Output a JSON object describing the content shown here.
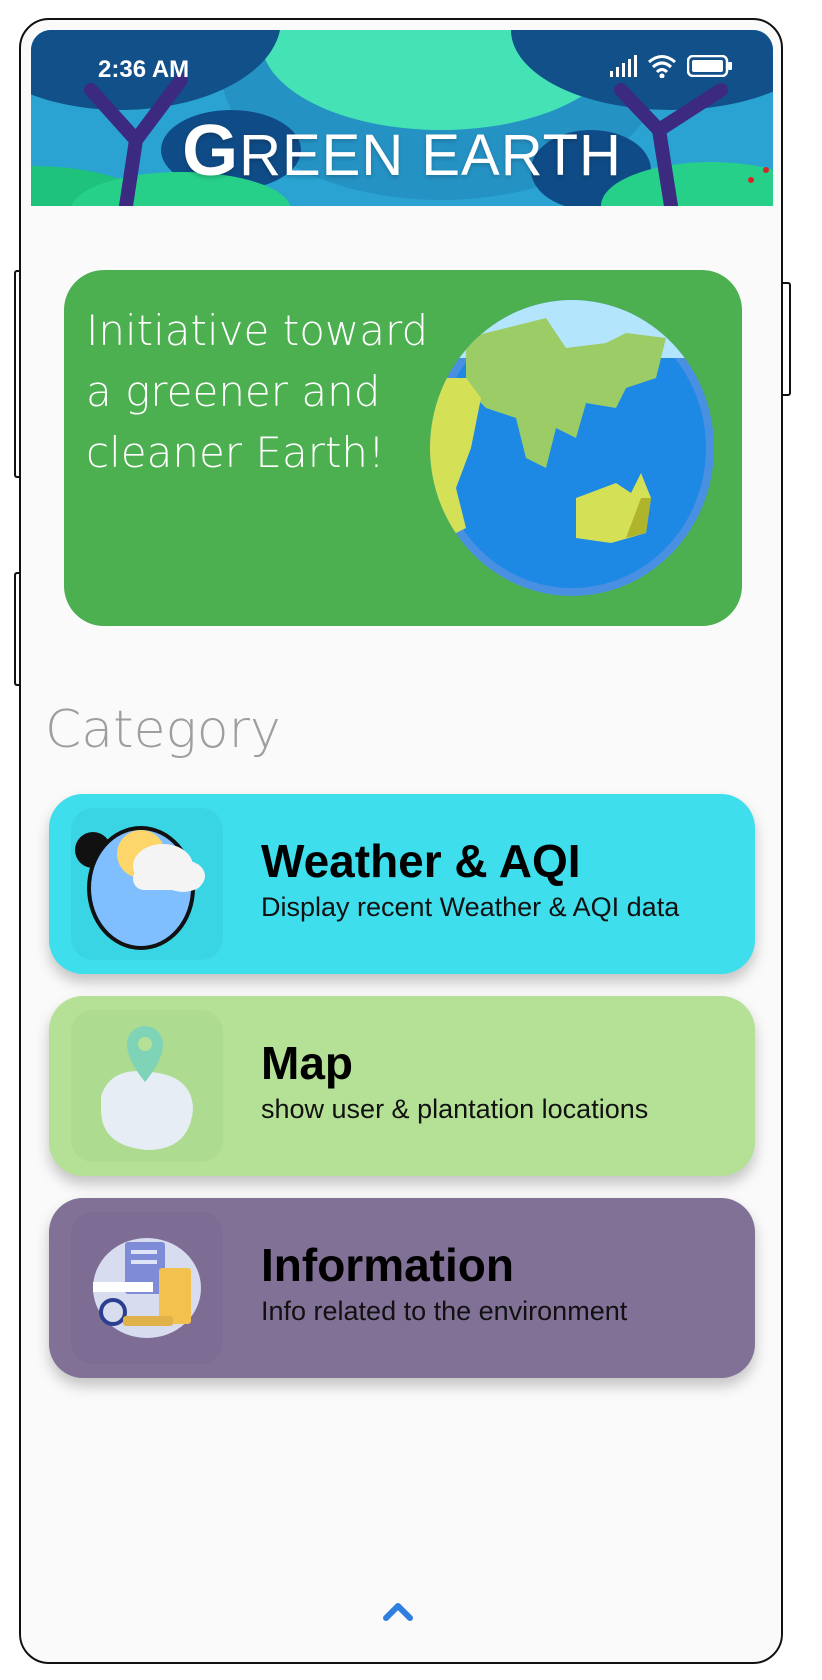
{
  "status_bar": {
    "time": "2:36 AM"
  },
  "header": {
    "title_first": "G",
    "title_rest": "REEN EARTH"
  },
  "banner": {
    "lines": [
      "Initiative toward",
      "a greener and",
      "cleaner Earth!"
    ]
  },
  "category": {
    "heading": "Category",
    "cards": [
      {
        "title": "Weather & AQI",
        "subtitle": "Display recent Weather & AQI data",
        "icon": "weather-icon",
        "color": "#3fdeed"
      },
      {
        "title": "Map",
        "subtitle": "show user & plantation locations",
        "icon": "map-pin-icon",
        "color": "#b4e196"
      },
      {
        "title": "Information",
        "subtitle": "Info related to the environment",
        "icon": "information-icon",
        "color": "#817196"
      }
    ]
  },
  "colors": {
    "banner": "#4caf50",
    "background": "#fafafa",
    "header": "#2ba3d0"
  }
}
